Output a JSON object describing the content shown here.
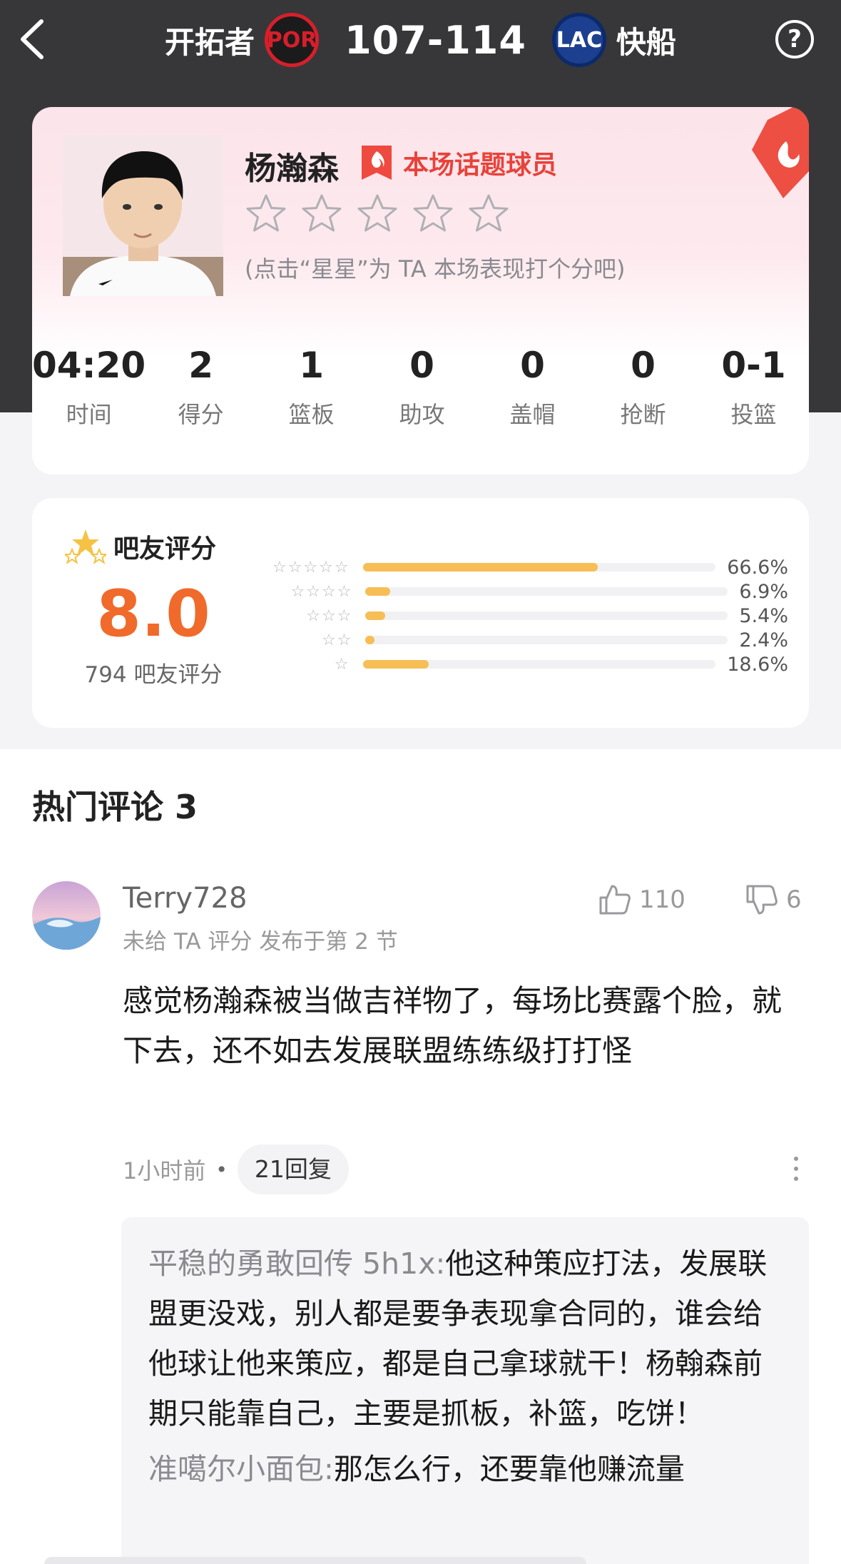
{
  "header": {
    "home_team": "开拓者",
    "home_abbr": "POR",
    "score": "107-114",
    "away_abbr": "LAC",
    "away_team": "快船",
    "help_label": "?"
  },
  "player": {
    "name": "杨瀚森",
    "hot_tag": "本场话题球员",
    "rate_hint": "(点击“星星”为 TA 本场表现打个分吧)",
    "stats": [
      {
        "value": "04:20",
        "label": "时间"
      },
      {
        "value": "2",
        "label": "得分"
      },
      {
        "value": "1",
        "label": "篮板"
      },
      {
        "value": "0",
        "label": "助攻"
      },
      {
        "value": "0",
        "label": "盖帽"
      },
      {
        "value": "0",
        "label": "抢断"
      },
      {
        "value": "0-1",
        "label": "投篮"
      }
    ]
  },
  "rating": {
    "title": "吧友评分",
    "score": "8.0",
    "count": "794 吧友评分",
    "distribution": [
      {
        "stars": "☆☆☆☆☆",
        "pct": "66.6%",
        "value": 66.6
      },
      {
        "stars": "☆☆☆☆",
        "pct": "6.9%",
        "value": 6.9
      },
      {
        "stars": "☆☆☆",
        "pct": "5.4%",
        "value": 5.4
      },
      {
        "stars": "☆☆",
        "pct": "2.4%",
        "value": 2.4
      },
      {
        "stars": "☆",
        "pct": "18.6%",
        "value": 18.6
      }
    ]
  },
  "comments": {
    "title": "热门评论 3",
    "items": [
      {
        "user": "Terry728",
        "meta": "未给 TA 评分  发布于第 2 节",
        "likes": "110",
        "dislikes": "6",
        "body": "感觉杨瀚森被当做吉祥物了，每场比赛露个脸，就下去，还不如去发展联盟练练级打打怪",
        "time": "1小时前",
        "dot": "•",
        "replies_label": "21回复",
        "replies": [
          {
            "name": "平稳的勇敢回传 5h1x",
            "sep": ":",
            "text": "他这种策应打法，发展联盟更没戏，别人都是要争表现拿合同的，谁会给他球让他来策应，都是自己拿球就干！杨翰森前期只能靠自己，主要是抓板，补篮，吃饼！"
          },
          {
            "name": "准噶尔小面包",
            "sep": ":",
            "text": "那怎么行，还要靠他赚流量"
          }
        ]
      }
    ]
  },
  "colors": {
    "header_bg": "#373739",
    "accent_red": "#e8423a",
    "score_orange": "#f06a2b",
    "bar_yellow": "#f6be55"
  },
  "icons": {
    "back": "chevron-left-icon",
    "help": "question-circle-icon",
    "hot": "flame-badge-icon",
    "star": "star-outline-icon",
    "rating": "stars-icon",
    "like": "thumbs-up-icon",
    "dislike": "thumbs-down-icon",
    "more": "more-vertical-icon"
  }
}
